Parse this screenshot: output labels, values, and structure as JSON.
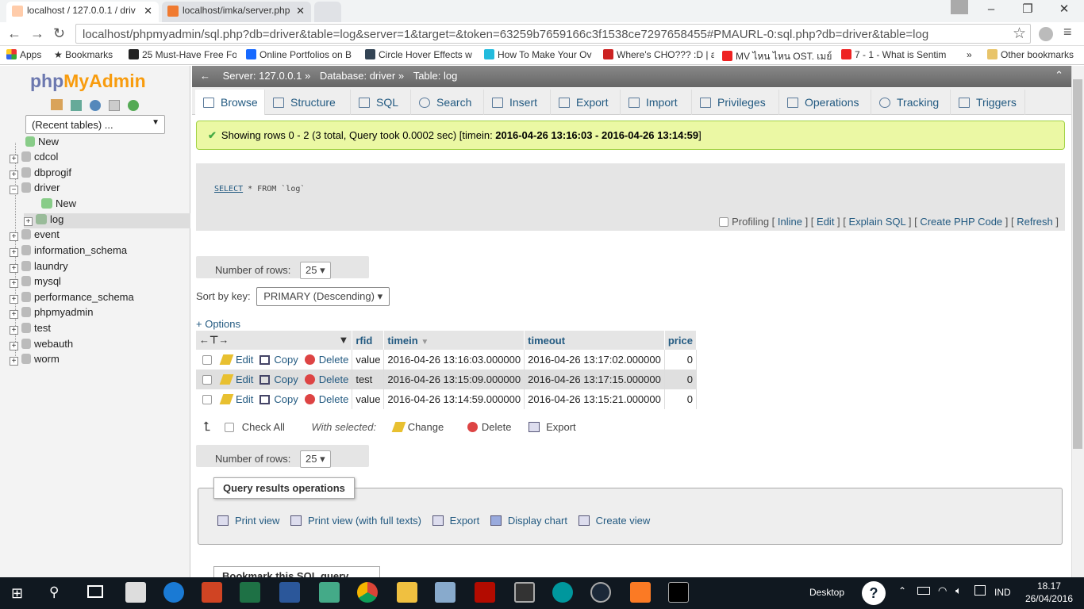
{
  "browser": {
    "tabs": [
      {
        "title": "localhost / 127.0.0.1 / driv",
        "active": true
      },
      {
        "title": "localhost/imka/server.php",
        "active": false
      }
    ],
    "url": "localhost/phpmyadmin/sql.php?db=driver&table=log&server=1&target=&token=63259b7659166c3f1538ce7297658455#PMAURL-0:sql.php?db=driver&table=log",
    "bookmarks": [
      "Apps",
      "Bookmarks",
      "25 Must-Have Free Fo",
      "Online Portfolios on B",
      "Circle Hover Effects w",
      "How To Make Your Ov",
      "Where's CHO??? :D | a",
      "MV ไหน ไหน OST. เมย์",
      "7 - 1 - What is Sentim",
      "»",
      "Other bookmarks"
    ]
  },
  "nav": {
    "logo_php": "php",
    "logo_myadmin": "MyAdmin",
    "recent_tables": "(Recent tables) ...",
    "items": [
      {
        "label": "New"
      },
      {
        "label": "cdcol"
      },
      {
        "label": "dbprogif"
      },
      {
        "label": "driver"
      },
      {
        "label": "New"
      },
      {
        "label": "log"
      },
      {
        "label": "event"
      },
      {
        "label": "information_schema"
      },
      {
        "label": "laundry"
      },
      {
        "label": "mysql"
      },
      {
        "label": "performance_schema"
      },
      {
        "label": "phpmyadmin"
      },
      {
        "label": "test"
      },
      {
        "label": "webauth"
      },
      {
        "label": "worm"
      }
    ]
  },
  "breadcrumb": {
    "server": "Server: 127.0.0.1 »",
    "database": "Database: driver »",
    "table": "Table: log"
  },
  "tabs": [
    "Browse",
    "Structure",
    "SQL",
    "Search",
    "Insert",
    "Export",
    "Import",
    "Privileges",
    "Operations",
    "Tracking",
    "Triggers"
  ],
  "success": {
    "prefix": "Showing rows 0 - 2 (3 total, Query took 0.0002 sec) [timein: ",
    "range": "2016-04-26 13:16:03 - 2016-04-26 13:14:59",
    "suffix": "]"
  },
  "sql": {
    "kw1": "SELECT",
    "rest": " * FROM `log`",
    "profiling": "Profiling",
    "links": [
      "Inline",
      "Edit",
      "Explain SQL",
      "Create PHP Code",
      "Refresh"
    ]
  },
  "rows_label": "Number of rows:",
  "rows_value": "25",
  "sort_label": "Sort by key:",
  "sort_value": "PRIMARY (Descending)",
  "options_label": "+ Options",
  "table": {
    "columns": [
      "rfid",
      "timein",
      "timeout",
      "price"
    ],
    "actions": {
      "edit": "Edit",
      "copy": "Copy",
      "delete": "Delete"
    },
    "rows": [
      {
        "rfid": "value",
        "timein": "2016-04-26 13:16:03.000000",
        "timeout": "2016-04-26 13:17:02.000000",
        "price": "0"
      },
      {
        "rfid": "test",
        "timein": "2016-04-26 13:15:09.000000",
        "timeout": "2016-04-26 13:17:15.000000",
        "price": "0"
      },
      {
        "rfid": "value",
        "timein": "2016-04-26 13:14:59.000000",
        "timeout": "2016-04-26 13:15:21.000000",
        "price": "0"
      }
    ]
  },
  "with_selected": {
    "check_all": "Check All",
    "label": "With selected:",
    "change": "Change",
    "delete": "Delete",
    "export": "Export"
  },
  "qro": {
    "legend": "Query results operations",
    "links": [
      "Print view",
      "Print view (with full texts)",
      "Export",
      "Display chart",
      "Create view"
    ]
  },
  "bookmark_box": "Bookmark this SQL query",
  "taskbar": {
    "desktop": "Desktop",
    "lang": "IND",
    "time": "18.17",
    "date": "26/04/2016"
  },
  "colors": {
    "accent": "#235a81",
    "success_bg": "#ebf8a4",
    "logo_orange": "#f89c0e",
    "logo_blue": "#6c78af"
  }
}
